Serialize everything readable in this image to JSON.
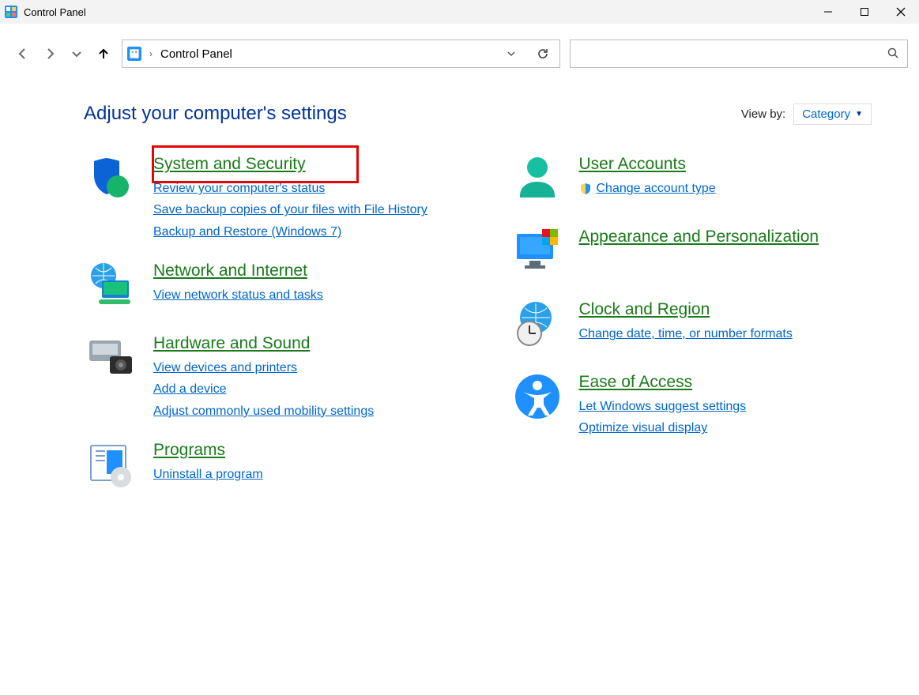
{
  "window": {
    "title": "Control Panel"
  },
  "breadcrumb": {
    "current": "Control Panel"
  },
  "heading": "Adjust your computer's settings",
  "viewby": {
    "label": "View by:",
    "value": "Category"
  },
  "categories": {
    "left": [
      {
        "id": "system-security",
        "title": "System and Security",
        "highlight": true,
        "links": [
          "Review your computer's status",
          "Save backup copies of your files with File History",
          "Backup and Restore (Windows 7)"
        ]
      },
      {
        "id": "network-internet",
        "title": "Network and Internet",
        "links": [
          "View network status and tasks"
        ]
      },
      {
        "id": "hardware-sound",
        "title": "Hardware and Sound",
        "links": [
          "View devices and printers",
          "Add a device",
          "Adjust commonly used mobility settings"
        ]
      },
      {
        "id": "programs",
        "title": "Programs",
        "links": [
          "Uninstall a program"
        ]
      }
    ],
    "right": [
      {
        "id": "user-accounts",
        "title": "User Accounts",
        "links": [
          "Change account type"
        ],
        "shieldLinks": [
          0
        ]
      },
      {
        "id": "appearance",
        "title": "Appearance and Personalization",
        "links": []
      },
      {
        "id": "clock-region",
        "title": "Clock and Region",
        "links": [
          "Change date, time, or number formats"
        ]
      },
      {
        "id": "ease-access",
        "title": "Ease of Access",
        "links": [
          "Let Windows suggest settings",
          "Optimize visual display"
        ]
      }
    ]
  }
}
